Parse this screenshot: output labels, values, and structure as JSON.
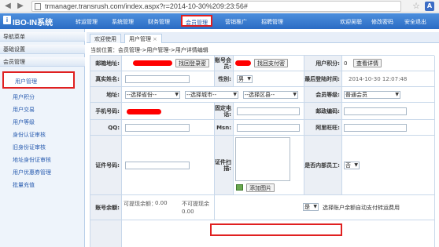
{
  "browser": {
    "url": "trmanager.transrush.com/index.aspx?r=2014-10-30%209:23:56#",
    "back_icon": "back-arrow-icon",
    "forward_icon": "forward-arrow-icon",
    "ext_label": "A"
  },
  "app": {
    "logo": "IBO-IN系统",
    "logo_mark": "i",
    "nav": [
      "转运管理",
      "系统管理",
      "财务管理",
      "会员管理",
      "营销推广",
      "招聘管理"
    ],
    "active_nav": "会员管理",
    "right_links": [
      "欢迎吴聪",
      "修改密码",
      "安全退出"
    ]
  },
  "sidebar": {
    "title": "导航菜单",
    "sections": [
      "基础设置",
      "会员管理"
    ],
    "active_item": "用户管理",
    "items": [
      "用户积分",
      "用户交易",
      "用户等级",
      "身份认证审核",
      "旧身份证审核",
      "地址身份证审核",
      "用户优惠券管理",
      "批量充值"
    ]
  },
  "tabs": [
    {
      "label": "欢迎使用",
      "active": false
    },
    {
      "label": "用户管理",
      "active": true,
      "close": "×"
    }
  ],
  "breadcrumb": "当前位置：会员管理->用户管理->用户详情编辑",
  "form": {
    "labels": {
      "email": "邮箱地址:",
      "account": "账号会员:",
      "points": "用户积分:",
      "realname": "真实姓名:",
      "gender": "性别:",
      "last_login": "最后登陆时间:",
      "address": "地址:",
      "level": "会员等级:",
      "phone": "手机号码:",
      "tel": "固定电话:",
      "zip": "邮政编码:",
      "qq": "QQ:",
      "msn": "Msn:",
      "aliwangwang": "阿里旺旺:",
      "id_no": "证件号码:",
      "id_scan": "证件扫描:",
      "is_staff": "是否内部员工:",
      "account_balance": "账号余额:"
    },
    "buttons": {
      "find_login_pwd": "找回登录密",
      "find_pay_pwd": "找回支付密",
      "view_detail": "查看详情",
      "add_image": "添加图片"
    },
    "values": {
      "points": "0",
      "gender": "男",
      "last_login": "2014-10-30 12:07:48",
      "province": "--选择省份--",
      "city": "--选择城市--",
      "district": "--选择区县--",
      "level": "普通会员",
      "is_staff": "否",
      "usable_balance_label": "可提现余额：",
      "usable_balance": "0.00",
      "unusable_balance_label": "不可提现余",
      "unusable_balance": "0.00",
      "auto_pay": "是",
      "auto_pay_text": "选择账户余额自动支付转运费用"
    }
  }
}
